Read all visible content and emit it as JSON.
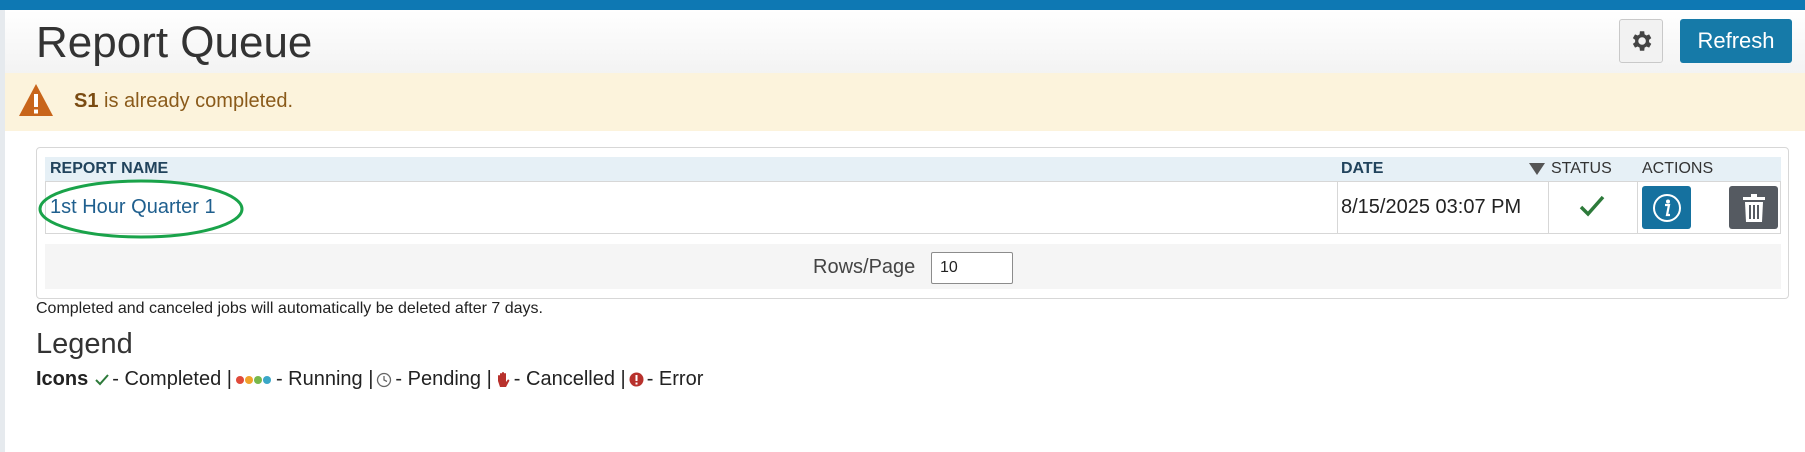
{
  "header": {
    "title": "Report Queue",
    "settings_icon": "gear-icon",
    "refresh_label": "Refresh"
  },
  "alert": {
    "icon": "warning-icon",
    "bold": "S1",
    "message": " is already completed."
  },
  "table": {
    "columns": [
      "REPORT NAME",
      "DATE",
      "STATUS",
      "ACTIONS"
    ],
    "sort_icon": "sort-desc-icon",
    "rows": [
      {
        "report_name": "1st Hour Quarter 1",
        "date": "8/15/2025 03:07 PM",
        "status_icon": "check-icon",
        "actions": [
          "info-icon",
          "trash-icon"
        ]
      }
    ]
  },
  "pager": {
    "label": "Rows/Page",
    "value": "10"
  },
  "note": "Completed and canceled jobs will automatically be deleted after 7 days.",
  "legend": {
    "title": "Legend",
    "icons_label": "Icons",
    "completed": "- Completed |",
    "running": "- Running |",
    "pending": "- Pending |",
    "cancelled": "- Cancelled |",
    "error": "- Error"
  },
  "colors": {
    "top_bar": "#0e78b3",
    "refresh": "#167aa8",
    "alert_bg": "#fcf3dc",
    "highlight": "#1aa34a",
    "check": "#2d7a3a"
  }
}
